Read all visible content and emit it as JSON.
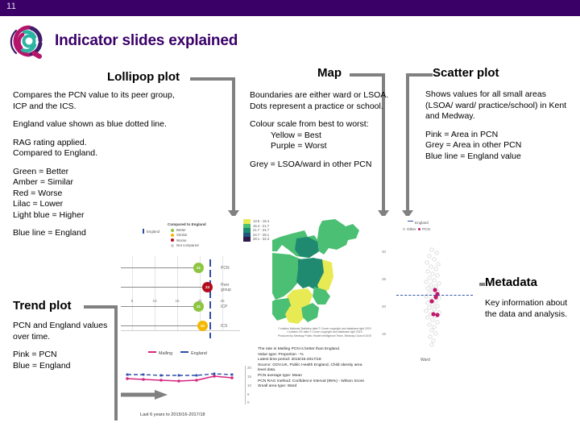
{
  "header": {
    "page_number": "11",
    "title": "Indicator slides explained",
    "bar_color": "#3a0068",
    "logo_name": "kent-medway-swirl-logo"
  },
  "sections": {
    "lollipop": {
      "heading": "Lollipop plot",
      "paragraphs": [
        "Compares the PCN value to its peer group, ICP and the ICS.",
        "England value shown as blue dotted line.",
        "RAG rating applied.\nCompared to England."
      ],
      "legend_lines": [
        "Green = Better",
        "Amber = Similar",
        "Red = Worse",
        "Lilac = Lower",
        "Light blue = Higher"
      ],
      "footnote": "Blue line = England"
    },
    "map": {
      "heading": "Map",
      "paragraphs": [
        "Boundaries are either ward or LSOA.",
        "Dots represent a practice or school."
      ],
      "scale_intro": "Colour scale from best to worst:",
      "scale_lines": [
        "Yellow = Best",
        "Purple = Worst"
      ],
      "footnote": "Grey = LSOA/ward in other PCN"
    },
    "scatter": {
      "heading": "Scatter plot",
      "paragraphs": [
        "Shows values for all small areas (LSOA/ ward/ practice/school) in Kent and Medway."
      ],
      "legend_lines": [
        "Pink = Area in PCN",
        "Grey = Area in other PCN",
        "Blue line = England value"
      ]
    },
    "trend": {
      "heading": "Trend plot",
      "paragraphs": [
        "PCN and England values over time."
      ],
      "legend_lines": [
        "Pink = PCN",
        "Blue = England"
      ]
    },
    "metadata": {
      "heading": "Metadata",
      "paragraphs": [
        "Key information about the data and analysis."
      ]
    }
  },
  "slide_preview": {
    "lollipop": {
      "legend_title": "Compared to England",
      "legend_england": "England",
      "legend_items": [
        {
          "label": "Better",
          "color": "#8cc63f"
        },
        {
          "label": "Similar",
          "color": "#f5b800"
        },
        {
          "label": "Worse",
          "color": "#b30c1c"
        },
        {
          "label": "Not compared",
          "color": "#cfcfcf"
        }
      ],
      "x_ticks": [
        "5",
        "10",
        "15",
        "20",
        "25"
      ],
      "rows": [
        {
          "label": "PCN",
          "value": "21",
          "color": "#8cc63f"
        },
        {
          "label": "Peer group",
          "value": "23",
          "color": "#b30c1c"
        },
        {
          "label": "ICP",
          "value": "21",
          "color": "#8cc63f"
        },
        {
          "label": "ICS",
          "value": "22",
          "color": "#f5b800"
        }
      ]
    },
    "trend": {
      "legend": [
        {
          "label": "Malling",
          "color": "#d6267f"
        },
        {
          "label": "England",
          "color": "#2f4ea8"
        }
      ],
      "y_ticks": [
        "20",
        "15",
        "10",
        "5",
        "0"
      ],
      "caption": "Last 6 years to 2015/16-2017/18"
    },
    "map": {
      "legend_bands": [
        {
          "range": "13.5 - 16.4",
          "color": "#e8ea54"
        },
        {
          "range": "16.4 - 21.7",
          "color": "#4bbf73"
        },
        {
          "range": "21.7 - 24.7",
          "color": "#1f8a70"
        },
        {
          "range": "24.7 - 28.1",
          "color": "#20557a"
        },
        {
          "range": "28.1 - 32.3",
          "color": "#2e1a4a"
        }
      ],
      "source_lines": [
        "Contains National Statistics data © Crown copyright and database right 2019",
        "Contains OS data © Crown copyright and database right 2019",
        "Produced by Medway Public Health Intelligence Team, Medway Council 2019"
      ]
    },
    "metadata_text": [
      "The rate in Malling PCN is better than England.",
      "Value type: Proportion - %",
      "Latest time period: 2015/16-2017/18",
      "Source: GOV.UK, Public Health England, Child obesity area",
      "level data.",
      "PCN average type: Mean",
      "PCN RAG method: Confidence interval (95%) - Wilson Score",
      "Small area type: Ward"
    ],
    "scatter": {
      "legend": [
        {
          "label": "England",
          "color": "#2f4ea8",
          "shape": "line"
        },
        {
          "label": "Other",
          "color": "#c9c9c9",
          "shape": "dot"
        },
        {
          "label": "PCN",
          "color": "#c2166b",
          "shape": "dot"
        }
      ],
      "y_ticks": [
        "30",
        "25",
        "20",
        "15"
      ],
      "x_label": "Ward"
    }
  }
}
